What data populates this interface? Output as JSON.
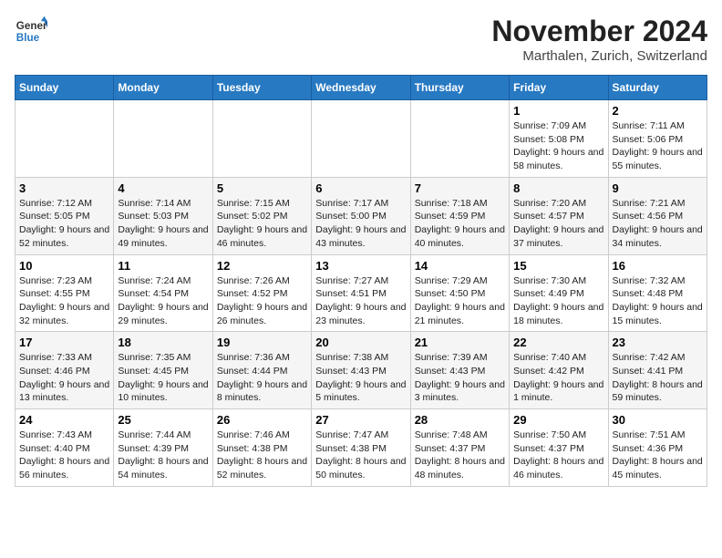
{
  "header": {
    "logo_line1": "General",
    "logo_line2": "Blue",
    "month": "November 2024",
    "location": "Marthalen, Zurich, Switzerland"
  },
  "weekdays": [
    "Sunday",
    "Monday",
    "Tuesday",
    "Wednesday",
    "Thursday",
    "Friday",
    "Saturday"
  ],
  "weeks": [
    [
      {
        "day": "",
        "info": ""
      },
      {
        "day": "",
        "info": ""
      },
      {
        "day": "",
        "info": ""
      },
      {
        "day": "",
        "info": ""
      },
      {
        "day": "",
        "info": ""
      },
      {
        "day": "1",
        "info": "Sunrise: 7:09 AM\nSunset: 5:08 PM\nDaylight: 9 hours and 58 minutes."
      },
      {
        "day": "2",
        "info": "Sunrise: 7:11 AM\nSunset: 5:06 PM\nDaylight: 9 hours and 55 minutes."
      }
    ],
    [
      {
        "day": "3",
        "info": "Sunrise: 7:12 AM\nSunset: 5:05 PM\nDaylight: 9 hours and 52 minutes."
      },
      {
        "day": "4",
        "info": "Sunrise: 7:14 AM\nSunset: 5:03 PM\nDaylight: 9 hours and 49 minutes."
      },
      {
        "day": "5",
        "info": "Sunrise: 7:15 AM\nSunset: 5:02 PM\nDaylight: 9 hours and 46 minutes."
      },
      {
        "day": "6",
        "info": "Sunrise: 7:17 AM\nSunset: 5:00 PM\nDaylight: 9 hours and 43 minutes."
      },
      {
        "day": "7",
        "info": "Sunrise: 7:18 AM\nSunset: 4:59 PM\nDaylight: 9 hours and 40 minutes."
      },
      {
        "day": "8",
        "info": "Sunrise: 7:20 AM\nSunset: 4:57 PM\nDaylight: 9 hours and 37 minutes."
      },
      {
        "day": "9",
        "info": "Sunrise: 7:21 AM\nSunset: 4:56 PM\nDaylight: 9 hours and 34 minutes."
      }
    ],
    [
      {
        "day": "10",
        "info": "Sunrise: 7:23 AM\nSunset: 4:55 PM\nDaylight: 9 hours and 32 minutes."
      },
      {
        "day": "11",
        "info": "Sunrise: 7:24 AM\nSunset: 4:54 PM\nDaylight: 9 hours and 29 minutes."
      },
      {
        "day": "12",
        "info": "Sunrise: 7:26 AM\nSunset: 4:52 PM\nDaylight: 9 hours and 26 minutes."
      },
      {
        "day": "13",
        "info": "Sunrise: 7:27 AM\nSunset: 4:51 PM\nDaylight: 9 hours and 23 minutes."
      },
      {
        "day": "14",
        "info": "Sunrise: 7:29 AM\nSunset: 4:50 PM\nDaylight: 9 hours and 21 minutes."
      },
      {
        "day": "15",
        "info": "Sunrise: 7:30 AM\nSunset: 4:49 PM\nDaylight: 9 hours and 18 minutes."
      },
      {
        "day": "16",
        "info": "Sunrise: 7:32 AM\nSunset: 4:48 PM\nDaylight: 9 hours and 15 minutes."
      }
    ],
    [
      {
        "day": "17",
        "info": "Sunrise: 7:33 AM\nSunset: 4:46 PM\nDaylight: 9 hours and 13 minutes."
      },
      {
        "day": "18",
        "info": "Sunrise: 7:35 AM\nSunset: 4:45 PM\nDaylight: 9 hours and 10 minutes."
      },
      {
        "day": "19",
        "info": "Sunrise: 7:36 AM\nSunset: 4:44 PM\nDaylight: 9 hours and 8 minutes."
      },
      {
        "day": "20",
        "info": "Sunrise: 7:38 AM\nSunset: 4:43 PM\nDaylight: 9 hours and 5 minutes."
      },
      {
        "day": "21",
        "info": "Sunrise: 7:39 AM\nSunset: 4:43 PM\nDaylight: 9 hours and 3 minutes."
      },
      {
        "day": "22",
        "info": "Sunrise: 7:40 AM\nSunset: 4:42 PM\nDaylight: 9 hours and 1 minute."
      },
      {
        "day": "23",
        "info": "Sunrise: 7:42 AM\nSunset: 4:41 PM\nDaylight: 8 hours and 59 minutes."
      }
    ],
    [
      {
        "day": "24",
        "info": "Sunrise: 7:43 AM\nSunset: 4:40 PM\nDaylight: 8 hours and 56 minutes."
      },
      {
        "day": "25",
        "info": "Sunrise: 7:44 AM\nSunset: 4:39 PM\nDaylight: 8 hours and 54 minutes."
      },
      {
        "day": "26",
        "info": "Sunrise: 7:46 AM\nSunset: 4:38 PM\nDaylight: 8 hours and 52 minutes."
      },
      {
        "day": "27",
        "info": "Sunrise: 7:47 AM\nSunset: 4:38 PM\nDaylight: 8 hours and 50 minutes."
      },
      {
        "day": "28",
        "info": "Sunrise: 7:48 AM\nSunset: 4:37 PM\nDaylight: 8 hours and 48 minutes."
      },
      {
        "day": "29",
        "info": "Sunrise: 7:50 AM\nSunset: 4:37 PM\nDaylight: 8 hours and 46 minutes."
      },
      {
        "day": "30",
        "info": "Sunrise: 7:51 AM\nSunset: 4:36 PM\nDaylight: 8 hours and 45 minutes."
      }
    ]
  ]
}
